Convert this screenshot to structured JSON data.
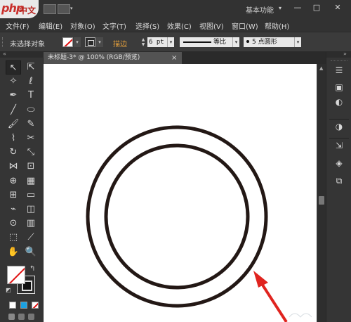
{
  "titlebar": {
    "logo_php": "php",
    "logo_cn": "中文网",
    "workspace": "基本功能",
    "workspace_caret": "▾",
    "min": "—",
    "max": "□",
    "close": "✕"
  },
  "menu": [
    "文件(F)",
    "编辑(E)",
    "对象(O)",
    "文字(T)",
    "选择(S)",
    "效果(C)",
    "视图(V)",
    "窗口(W)",
    "帮助(H)"
  ],
  "control": {
    "selection_label": "未选择对象",
    "stroke_label": "描边",
    "stroke_weight": "6 pt",
    "profile_label": "等比",
    "brush_label": "5 点圆形",
    "colors": {
      "fill": "#ffffff",
      "stroke_accent": "#e8a23c",
      "none_slash": "#e01010"
    }
  },
  "document": {
    "tab_title": "未标题-3* @ 100% (RGB/预览)",
    "close_glyph": "×"
  },
  "artwork": {
    "ring_color": "#231815",
    "arrow_color": "#e0241f",
    "background": "#ffffff"
  },
  "tools": [
    {
      "name": "selection-tool",
      "glyph": "↖"
    },
    {
      "name": "direct-selection-tool",
      "glyph": "⇱"
    },
    {
      "name": "magic-wand-tool",
      "glyph": "✧"
    },
    {
      "name": "lasso-tool",
      "glyph": "ℓ"
    },
    {
      "name": "pen-tool",
      "glyph": "✒"
    },
    {
      "name": "type-tool",
      "glyph": "T"
    },
    {
      "name": "line-tool",
      "glyph": "╱"
    },
    {
      "name": "ellipse-tool",
      "glyph": "⬭"
    },
    {
      "name": "paintbrush-tool",
      "glyph": "🖌"
    },
    {
      "name": "pencil-tool",
      "glyph": "✎"
    },
    {
      "name": "blob-brush-tool",
      "glyph": "⌇"
    },
    {
      "name": "scissors-tool",
      "glyph": "✂"
    },
    {
      "name": "rotate-tool",
      "glyph": "↻"
    },
    {
      "name": "scale-tool",
      "glyph": "⤡"
    },
    {
      "name": "width-tool",
      "glyph": "⋈"
    },
    {
      "name": "free-transform-tool",
      "glyph": "⊡"
    },
    {
      "name": "shape-builder-tool",
      "glyph": "⊕"
    },
    {
      "name": "perspective-grid-tool",
      "glyph": "▦"
    },
    {
      "name": "mesh-tool",
      "glyph": "⊞"
    },
    {
      "name": "gradient-tool",
      "glyph": "▭"
    },
    {
      "name": "eyedropper-tool",
      "glyph": "⌁"
    },
    {
      "name": "blend-tool",
      "glyph": "◫"
    },
    {
      "name": "symbol-sprayer-tool",
      "glyph": "⊙"
    },
    {
      "name": "column-graph-tool",
      "glyph": "▥"
    },
    {
      "name": "artboard-tool",
      "glyph": "⬚"
    },
    {
      "name": "slice-tool",
      "glyph": "⟋"
    },
    {
      "name": "hand-tool",
      "glyph": "✋"
    },
    {
      "name": "zoom-tool",
      "glyph": "🔍"
    }
  ],
  "right_panel_icons": [
    {
      "name": "panel-menu-icon",
      "glyph": "☰"
    },
    {
      "name": "color-guide-icon",
      "glyph": "▣"
    },
    {
      "name": "appearance-icon",
      "glyph": "◐"
    },
    {
      "name": "transparency-icon",
      "glyph": "◑"
    },
    {
      "name": "export-icon",
      "glyph": "⇲"
    },
    {
      "name": "layers-icon",
      "glyph": "◈"
    },
    {
      "name": "artboards-icon",
      "glyph": "⧉"
    }
  ],
  "bottom_swatches": [
    "#ffffff",
    "#1ba1e2",
    "#ffffff"
  ]
}
